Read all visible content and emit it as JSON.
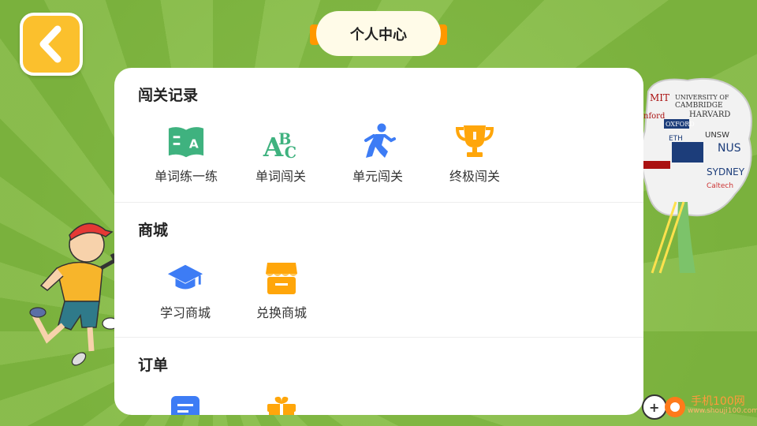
{
  "header": {
    "title": "个人中心"
  },
  "sections": [
    {
      "title": "闯关记录",
      "items": [
        {
          "label": "单词练一练",
          "icon": "book-letter-icon",
          "color": "#3fb27f"
        },
        {
          "label": "单词闯关",
          "icon": "abc-icon",
          "color": "#3fb27f"
        },
        {
          "label": "单元闯关",
          "icon": "runner-icon",
          "color": "#3d7cf5"
        },
        {
          "label": "终极闯关",
          "icon": "trophy-icon",
          "color": "#ffa60a"
        }
      ]
    },
    {
      "title": "商城",
      "items": [
        {
          "label": "学习商城",
          "icon": "graduation-cap-icon",
          "color": "#3d7cf5"
        },
        {
          "label": "兑换商城",
          "icon": "shop-icon",
          "color": "#ffa60a"
        }
      ]
    },
    {
      "title": "订单",
      "items": [
        {
          "label": "",
          "icon": "order-list-icon",
          "color": "#3d7cf5"
        },
        {
          "label": "",
          "icon": "gift-icon",
          "color": "#ffa60a"
        }
      ]
    }
  ],
  "colors": {
    "background": "#7cb342",
    "back_button": "#fbc02d",
    "pill": "#fffbe8",
    "pill_tab": "#ff9800"
  },
  "watermark": {
    "text": "手机100网",
    "subtext": "www.shouji100.com"
  }
}
